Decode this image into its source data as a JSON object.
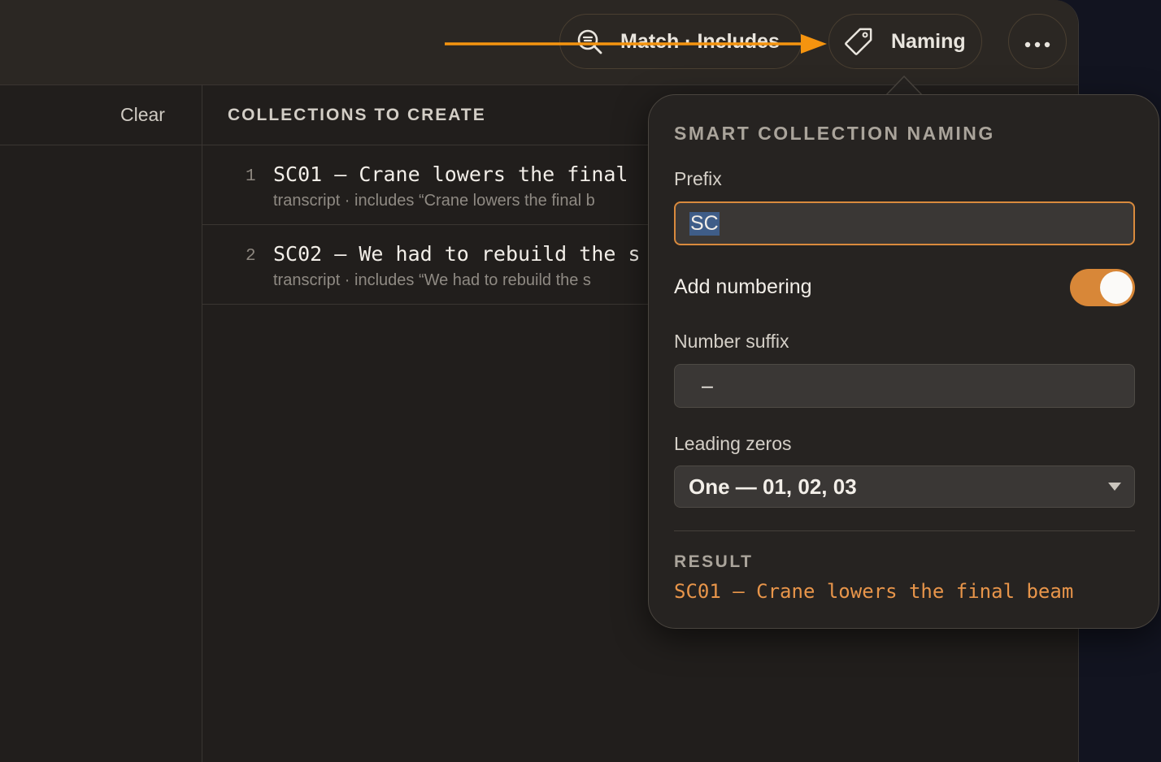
{
  "toolbar": {
    "match_label": "Match · Includes",
    "naming_label": "Naming",
    "more_icon": "ellipsis-icon",
    "match_icon": "search-filter-icon",
    "naming_icon": "tag-icon"
  },
  "left_panel": {
    "clear_label": "Clear"
  },
  "collections": {
    "heading": "COLLECTIONS TO CREATE",
    "items": [
      {
        "num": "1",
        "title": "SC01 – Crane lowers the final",
        "subtitle": "transcript · includes “Crane lowers the final b"
      },
      {
        "num": "2",
        "title": "SC02 – We had to rebuild the s",
        "subtitle": "transcript · includes “We had to rebuild the s"
      }
    ]
  },
  "naming_popover": {
    "title": "SMART COLLECTION NAMING",
    "prefix_label": "Prefix",
    "prefix_value": "SC",
    "numbering_label": "Add numbering",
    "numbering_enabled": true,
    "suffix_label": "Number suffix",
    "suffix_value": "–",
    "zeros_label": "Leading zeros",
    "zeros_value": "One — 01, 02, 03",
    "result_label": "RESULT",
    "result_value": "SC01 – Crane lowers the final beam"
  },
  "colors": {
    "accent": "#d88738",
    "annotation_arrow": "#f5940f",
    "result_text": "#e8954a",
    "selection": "#3f5d88",
    "background": "#211e1c"
  }
}
